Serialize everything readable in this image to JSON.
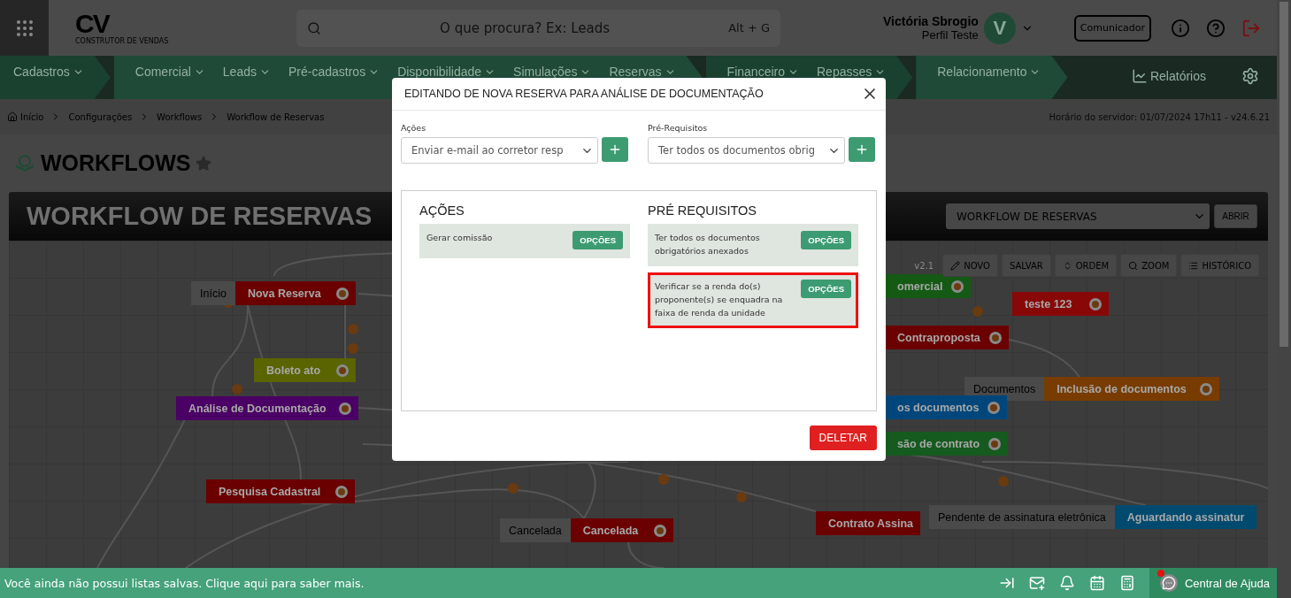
{
  "topbar": {
    "logo": {
      "mark": "CV",
      "tagline": "CONSTRUTOR DE VENDAS"
    },
    "search_placeholder": "O que procura? Ex: Leads",
    "search_shortcut": "Alt + G",
    "user_name": "Victória Sbrogio",
    "user_profile": "Perfil Teste",
    "avatar_initial": "V",
    "communicator_button": "Comunicador"
  },
  "nav": {
    "groups": [
      {
        "items": [
          "Cadastros"
        ]
      },
      {
        "items": [
          "Comercial",
          "Leads",
          "Pré-cadastros",
          "Disponibilidade",
          "Simulações",
          "Reservas"
        ]
      },
      {
        "items": [
          "Financeiro",
          "Repasses"
        ]
      },
      {
        "items": [
          "Relacionamento"
        ]
      }
    ],
    "reports": "Relatórios"
  },
  "breadcrumb": [
    "Início",
    "Configurações",
    "Workflows",
    "Workflow de Reservas"
  ],
  "server_time": "Horário do servidor: 01/07/2024 17h11 - v24.6.21",
  "page_title": {
    "text": "WORKFLOWS",
    "favorite": false
  },
  "workflow": {
    "title": "WORKFLOW DE RESERVAS",
    "select_value": "WORKFLOW DE RESERVAS",
    "open_button": "ABRIR",
    "version": "v2.1",
    "toolbar": [
      {
        "label": "NOVO",
        "kind": "pencil"
      },
      {
        "label": "SALVAR",
        "kind": "plain"
      },
      {
        "label": "ORDEM",
        "kind": "sort"
      },
      {
        "label": "ZOOM",
        "kind": "search"
      },
      {
        "label": "HISTÓRICO",
        "kind": "list"
      }
    ],
    "nodes": [
      {
        "tag": "Início",
        "label": "Nova Reserva",
        "color": "#6a0000",
        "handle": true
      },
      {
        "label": "Boleto ato",
        "color": "#5a6400",
        "handle": true
      },
      {
        "label": "Análise de Documentação",
        "color": "#4a0064",
        "handle": true
      },
      {
        "label": "Pesquisa Cadastral",
        "color": "#6a0000",
        "handle": true
      },
      {
        "tag": "Cancelada",
        "label": "Cancelada",
        "color": "#6a0000",
        "handle": true
      },
      {
        "label": "omercial",
        "color": "#145a14",
        "handle": true
      },
      {
        "label": "teste 123",
        "color": "#880808",
        "handle": true
      },
      {
        "label": "Contraproposta",
        "color": "#6a0000",
        "handle": true
      },
      {
        "tag": "Documentos",
        "label": "Inclusão de documentos",
        "color": "#783c00",
        "handle": true
      },
      {
        "label": "os documentos",
        "color": "#00467a",
        "handle": true
      },
      {
        "label": "são de contrato",
        "color": "#155a1e",
        "handle": true
      },
      {
        "label": "Contrato Assina",
        "color": "#6a0000",
        "handle": false
      },
      {
        "tag": "Pendente de assinatura eletrônica",
        "label": "Aguardando assinatur",
        "color": "#004a70",
        "handle": false
      }
    ]
  },
  "modal": {
    "title": "EDITANDO DE NOVA RESERVA PARA ANÁLISE DE DOCUMENTAÇÃO",
    "pickers": [
      {
        "label": "Ações",
        "value": "Enviar e-mail ao corretor resp"
      },
      {
        "label": "Pré-Requisitos",
        "value": "Ter todos os documentos obrig"
      }
    ],
    "columns": [
      {
        "heading": "AÇÕES",
        "items": [
          {
            "text": "Gerar comissão",
            "button": "OPÇÕES",
            "selected": false
          }
        ]
      },
      {
        "heading": "PRÉ REQUISITOS",
        "items": [
          {
            "text": "Ter todos os documentos obrigatórios anexados",
            "button": "OPÇÕES",
            "selected": false
          },
          {
            "text": "Verificar se a renda do(s) proponente(s) se enquadra na faixa de renda da unidade",
            "button": "OPÇÕES",
            "selected": true
          }
        ]
      }
    ],
    "delete_button": "DELETAR"
  },
  "footer": {
    "message": "Você ainda não possui listas salvas. Clique aqui para saber mais.",
    "help": "Central de Ajuda",
    "help_notification": true
  }
}
